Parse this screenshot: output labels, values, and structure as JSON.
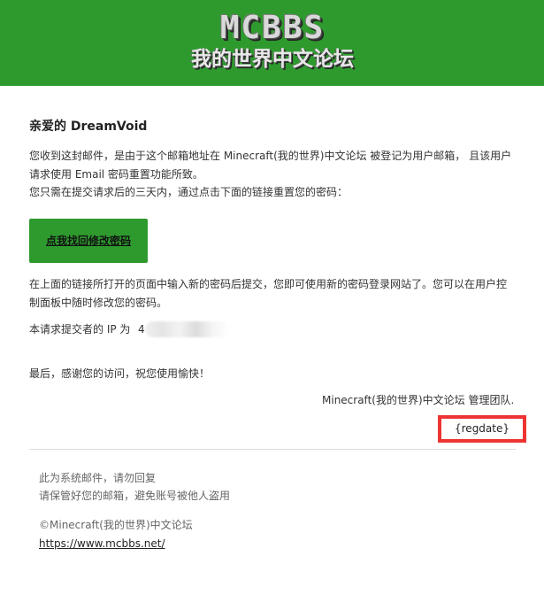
{
  "header": {
    "logo_main": "MCBBS",
    "logo_sub": "我的世界中文论坛",
    "bg_color": "#2e9a2e"
  },
  "email": {
    "greeting": "亲爱的 DreamVoid",
    "para1_line1": "您收到这封邮件，是由于这个邮箱地址在 Minecraft(我的世界)中文论坛 被登记为用户邮箱， 且该用户",
    "para1_line2": "请求使用 Email 密码重置功能所致。",
    "para1_line3": "您只需在提交请求后的三天内，通过点击下面的链接重置您的密码：",
    "reset_button": "点我找回修改密码",
    "para2_line1": "在上面的链接所打开的页面中输入新的密码后提交，您即可使用新的密码登录网站了。您可以在用户控",
    "para2_line2": "制面板中随时修改您的密码。",
    "ip_label": "本请求提交者的 IP 为",
    "ip_visible_prefix": "4",
    "closing": "最后，感谢您的访问，祝您使用愉快！",
    "signature": "Minecraft(我的世界)中文论坛 管理团队.",
    "regdate": "{regdate}",
    "highlight_color": "#ee3333"
  },
  "footer": {
    "line1": "此为系统邮件，请勿回复",
    "line2": "请保管好您的邮箱，避免账号被他人盗用",
    "copyright": "©Minecraft(我的世界)中文论坛",
    "link": "https://www.mcbbs.net/"
  }
}
